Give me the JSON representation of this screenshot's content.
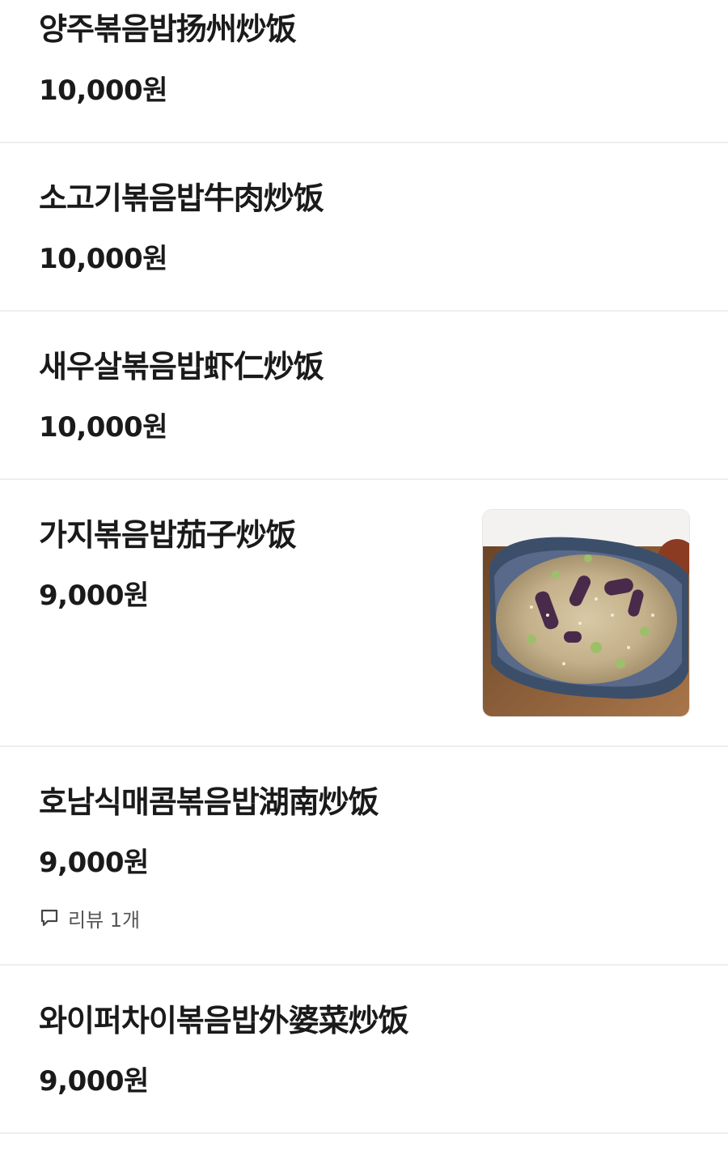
{
  "menu": {
    "items": [
      {
        "name": "양주볶음밥扬州炒饭",
        "price": "10,000원"
      },
      {
        "name": "소고기볶음밥牛肉炒饭",
        "price": "10,000원"
      },
      {
        "name": "새우살볶음밥虾仁炒饭",
        "price": "10,000원"
      },
      {
        "name": "가지볶음밥茄子炒饭",
        "price": "9,000원",
        "photo_icon": "eggplant-fried-rice-photo"
      },
      {
        "name": "호남식매콤볶음밥湖南炒饭",
        "price": "9,000원",
        "review": "리뷰 1개",
        "review_icon": "speech-bubble-icon"
      },
      {
        "name": "와이퍼차이볶음밥外婆菜炒饭",
        "price": "9,000원"
      }
    ]
  }
}
